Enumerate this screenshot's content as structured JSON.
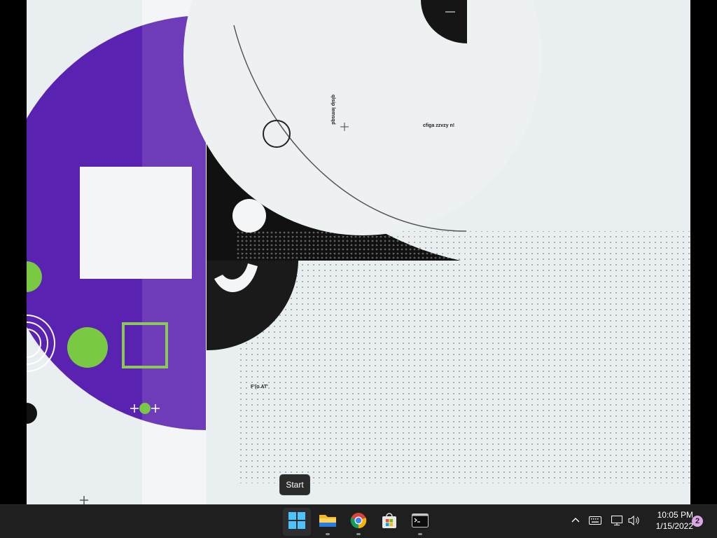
{
  "tooltip": {
    "text": "Start"
  },
  "wallpaper": {
    "text_a": "cfiga zzvzy n!",
    "text_b": "qlsip lemsqd",
    "text_c": "F'(o.AT'"
  },
  "taskbar": {
    "apps": [
      {
        "name": "Start",
        "icon": "windows-logo-icon",
        "active": true
      },
      {
        "name": "File Explorer",
        "icon": "folder-icon",
        "running": true
      },
      {
        "name": "Google Chrome",
        "icon": "chrome-icon",
        "running": true
      },
      {
        "name": "Microsoft Store",
        "icon": "store-icon",
        "running": false
      },
      {
        "name": "Terminal",
        "icon": "terminal-icon",
        "running": true
      }
    ],
    "tray": {
      "icons": [
        "chevron-up-icon",
        "keyboard-icon",
        "network-icon",
        "volume-icon"
      ],
      "time": "10:05 PM",
      "date": "1/15/2022",
      "notification_count": "2"
    }
  },
  "colors": {
    "purple": "#5a22b0",
    "green": "#7ac943",
    "paper": "#e9eef0",
    "taskbar": "#1f1f1f"
  }
}
